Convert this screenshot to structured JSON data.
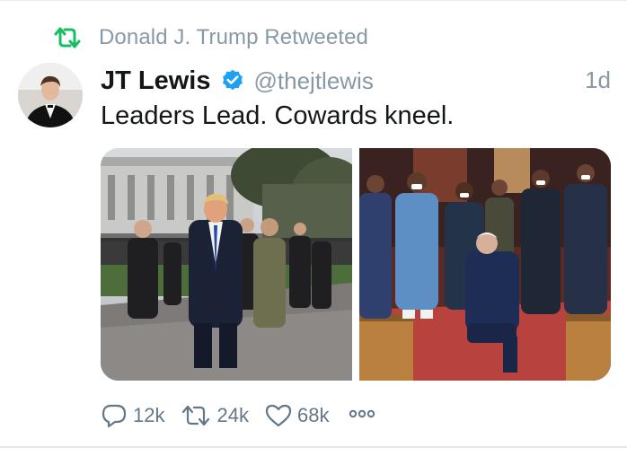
{
  "retweet_banner": {
    "text": "Donald J. Trump Retweeted"
  },
  "tweet": {
    "author_name": "JT Lewis",
    "handle": "@thejtlewis",
    "time": "1d",
    "text": "Leaders Lead. Cowards kneel.",
    "verified": true
  },
  "actions": {
    "replies": "12k",
    "retweets": "24k",
    "likes": "68k"
  },
  "colors": {
    "retweet_green": "#17bf63",
    "verified_blue": "#1da1f2",
    "muted": "#8899a6",
    "action_gray": "#657786"
  },
  "icons": {
    "retweet": "retweet-icon",
    "verified": "verified-badge-icon",
    "reply": "reply-icon",
    "like": "like-icon",
    "more": "more-icon"
  }
}
